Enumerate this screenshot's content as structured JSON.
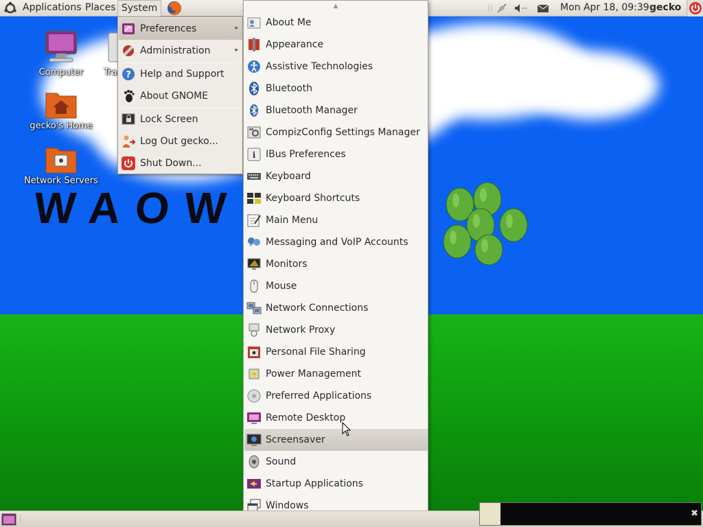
{
  "top_panel": {
    "menus": [
      "Applications",
      "Places",
      "System"
    ],
    "clock": "Mon Apr 18, 09:39",
    "user": "gecko"
  },
  "desktop": {
    "icons": [
      {
        "label": "Computer",
        "icon": "computer-icon"
      },
      {
        "label": "Tra",
        "icon": "trash-icon"
      },
      {
        "label": "gecko's Home",
        "icon": "home-folder-icon"
      },
      {
        "label": "Network Servers",
        "icon": "network-servers-icon"
      }
    ],
    "wallpaper_text": "WAOW"
  },
  "system_menu": {
    "items": [
      {
        "label": "Preferences",
        "icon": "preferences-icon",
        "submenu": true
      },
      {
        "label": "Administration",
        "icon": "administration-icon",
        "submenu": true
      },
      {
        "label": "Help and Support",
        "icon": "help-icon"
      },
      {
        "label": "About GNOME",
        "icon": "gnome-foot-icon"
      },
      {
        "label": "Lock Screen",
        "icon": "lock-icon"
      },
      {
        "label": "Log Out gecko...",
        "icon": "logout-icon"
      },
      {
        "label": "Shut Down...",
        "icon": "shutdown-icon"
      }
    ]
  },
  "preferences_menu": {
    "items": [
      {
        "label": "About Me",
        "icon": "about-me-icon"
      },
      {
        "label": "Appearance",
        "icon": "appearance-icon"
      },
      {
        "label": "Assistive Technologies",
        "icon": "accessibility-icon"
      },
      {
        "label": "Bluetooth",
        "icon": "bluetooth-icon"
      },
      {
        "label": "Bluetooth Manager",
        "icon": "bluetooth-manager-icon"
      },
      {
        "label": "CompizConfig Settings Manager",
        "icon": "compiz-icon"
      },
      {
        "label": "IBus Preferences",
        "icon": "ibus-icon"
      },
      {
        "label": "Keyboard",
        "icon": "keyboard-icon"
      },
      {
        "label": "Keyboard Shortcuts",
        "icon": "keyboard-shortcuts-icon"
      },
      {
        "label": "Main Menu",
        "icon": "main-menu-icon"
      },
      {
        "label": "Messaging and VoIP Accounts",
        "icon": "messaging-icon"
      },
      {
        "label": "Monitors",
        "icon": "monitor-icon"
      },
      {
        "label": "Mouse",
        "icon": "mouse-icon"
      },
      {
        "label": "Network Connections",
        "icon": "network-connections-icon"
      },
      {
        "label": "Network Proxy",
        "icon": "network-proxy-icon"
      },
      {
        "label": "Personal File Sharing",
        "icon": "file-sharing-icon"
      },
      {
        "label": "Power Management",
        "icon": "power-management-icon"
      },
      {
        "label": "Preferred Applications",
        "icon": "preferred-apps-icon"
      },
      {
        "label": "Remote Desktop",
        "icon": "remote-desktop-icon"
      },
      {
        "label": "Screensaver",
        "icon": "screensaver-icon"
      },
      {
        "label": "Sound",
        "icon": "sound-icon"
      },
      {
        "label": "Startup Applications",
        "icon": "startup-apps-icon"
      },
      {
        "label": "Windows",
        "icon": "windows-icon"
      }
    ],
    "highlighted": "Screensaver"
  },
  "colors": {
    "panel": "#e6e2db",
    "menu_bg": "#f7f5f2",
    "sky": "#0b61f2",
    "grass": "#13a513"
  }
}
